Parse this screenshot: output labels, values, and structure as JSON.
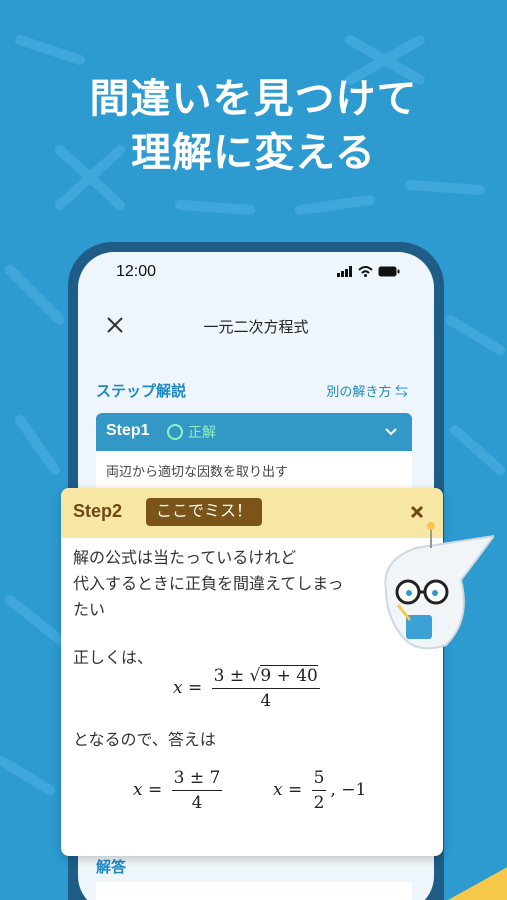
{
  "headline": {
    "line1": "間違いを見つけて",
    "line2": "理解に変える"
  },
  "status_bar": {
    "time": "12:00"
  },
  "nav": {
    "title": "一元二次方程式"
  },
  "section": {
    "title": "ステップ解説",
    "alt_link": "別の解き方 ⇆"
  },
  "step1": {
    "label": "Step1",
    "status": "正解",
    "description": "両辺から適切な因数を取り出す"
  },
  "card": {
    "step_label": "Step2",
    "badge": "ここでミス！",
    "explanation_line1": "解の公式は当たっているけれど",
    "explanation_line2": "代入するときに正負を間違えてしまっ",
    "explanation_line3": "たい",
    "correct_prefix": "正しくは、",
    "eq1": {
      "lhs": "x =",
      "num_pre": "3 ±",
      "sqrt": "9 + 40",
      "den": "4"
    },
    "conclusion": "となるので、答えは",
    "eq2": {
      "lhs": "x =",
      "num": "3 ± 7",
      "den": "4"
    },
    "eq3": {
      "lhs": "x =",
      "num": "5",
      "den": "2",
      "tail": ", −1"
    }
  },
  "answer": {
    "label": "解答"
  },
  "colors": {
    "background": "#2d9bd0",
    "accent": "#1f89c4",
    "card_header": "#f8e6a4",
    "badge": "#7a5418"
  }
}
